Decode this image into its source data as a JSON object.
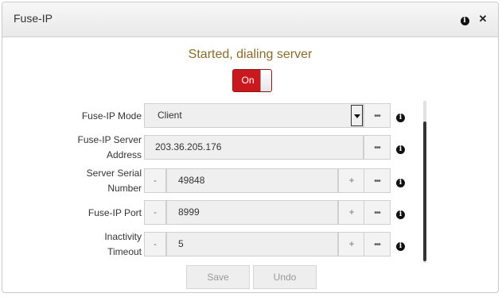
{
  "header": {
    "title": "Fuse-IP",
    "info_icon": "info-icon",
    "close_icon": "close-icon"
  },
  "status": {
    "text": "Started, dialing server",
    "color": "#8a6a2a"
  },
  "toggle": {
    "label": "On",
    "state": true,
    "color": "#c9181e"
  },
  "fields": {
    "mode": {
      "label": "Fuse-IP Mode",
      "value": "Client"
    },
    "server_address": {
      "label_line1": "Fuse-IP Server",
      "label_line2": "Address",
      "value": "203.36.205.176"
    },
    "serial_number": {
      "label_line1": "Server Serial",
      "label_line2": "Number",
      "value": "49848"
    },
    "port": {
      "label": "Fuse-IP Port",
      "value": "8999"
    },
    "inactivity_timeout": {
      "label_line1": "Inactivity",
      "label_line2": "Timeout",
      "value": "5"
    }
  },
  "controls": {
    "minus": "-",
    "plus": "+",
    "more": "•••",
    "info": "i"
  },
  "actions": {
    "save": "Save",
    "undo": "Undo"
  }
}
